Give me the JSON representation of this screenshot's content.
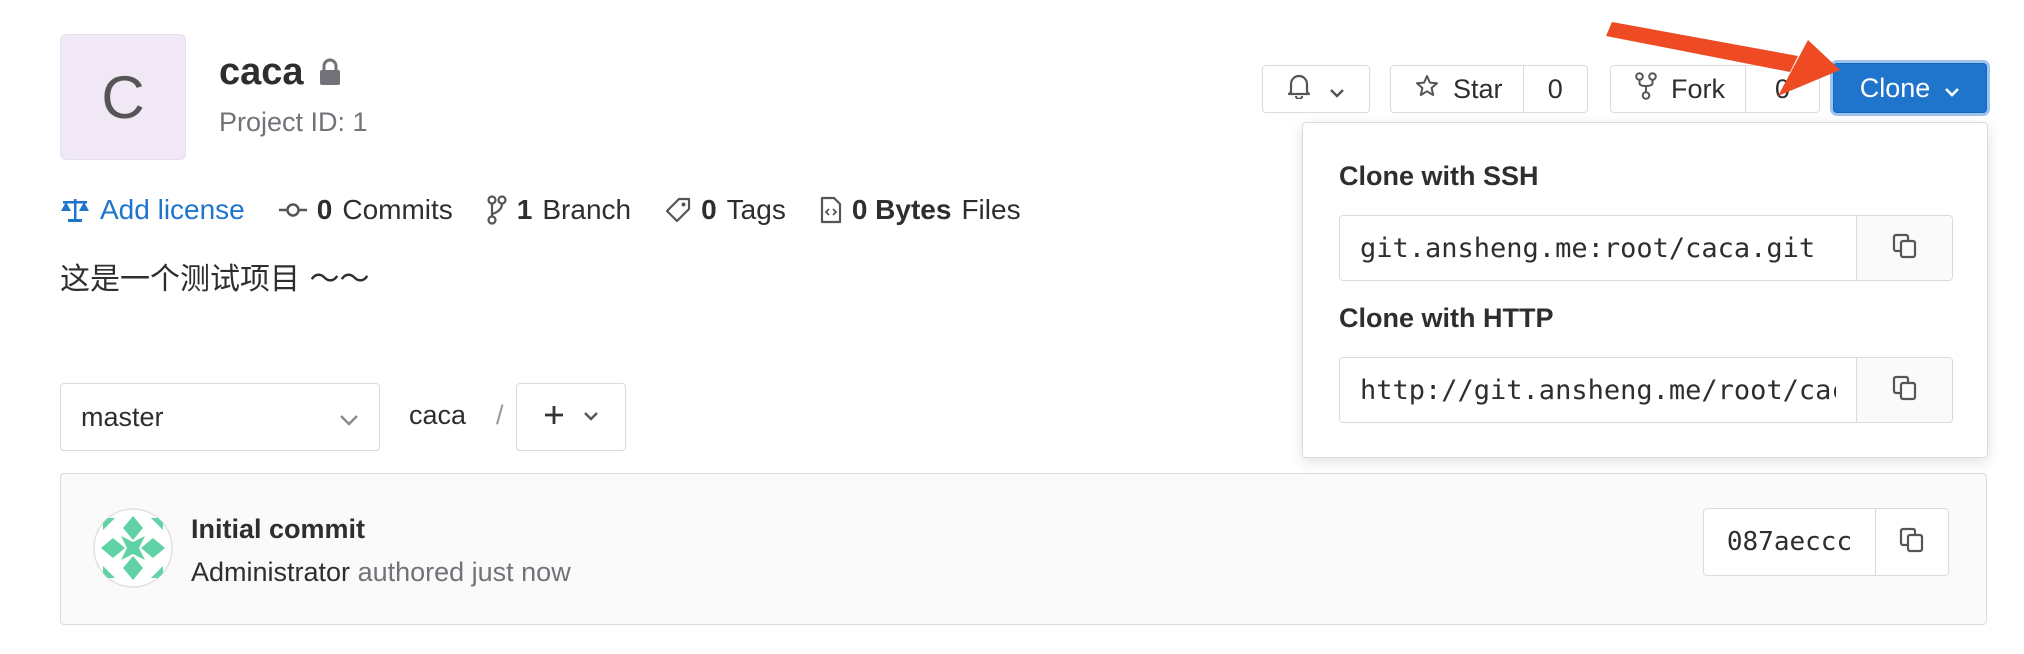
{
  "project": {
    "avatar_letter": "C",
    "name": "caca",
    "id_text": "Project ID: 1",
    "description": "这是一个测试项目 ～～"
  },
  "stats": {
    "license": "Add license",
    "commits_count": "0",
    "commits_label": "Commits",
    "branch_count": "1",
    "branch_label": "Branch",
    "tags_count": "0",
    "tags_label": "Tags",
    "files_size": "0 Bytes",
    "files_label": "Files"
  },
  "actions": {
    "star_label": "Star",
    "star_count": "0",
    "fork_label": "Fork",
    "fork_count": "0",
    "clone_label": "Clone"
  },
  "clone_dropdown": {
    "ssh_label": "Clone with SSH",
    "ssh_url": "git.ansheng.me:root/caca.git",
    "http_label": "Clone with HTTP",
    "http_url": "http://git.ansheng.me/root/caca.git"
  },
  "branch_bar": {
    "branch": "master",
    "path_root": "caca",
    "separator": "/"
  },
  "last_commit": {
    "title": "Initial commit",
    "author": "Administrator",
    "meta": "authored just now",
    "sha": "087aeccc"
  },
  "colors": {
    "primary": "#1f75cb",
    "avatar_bg": "#f0e8f5",
    "identicon": "#5fd3a5",
    "annotation_arrow": "#ee4b25"
  }
}
